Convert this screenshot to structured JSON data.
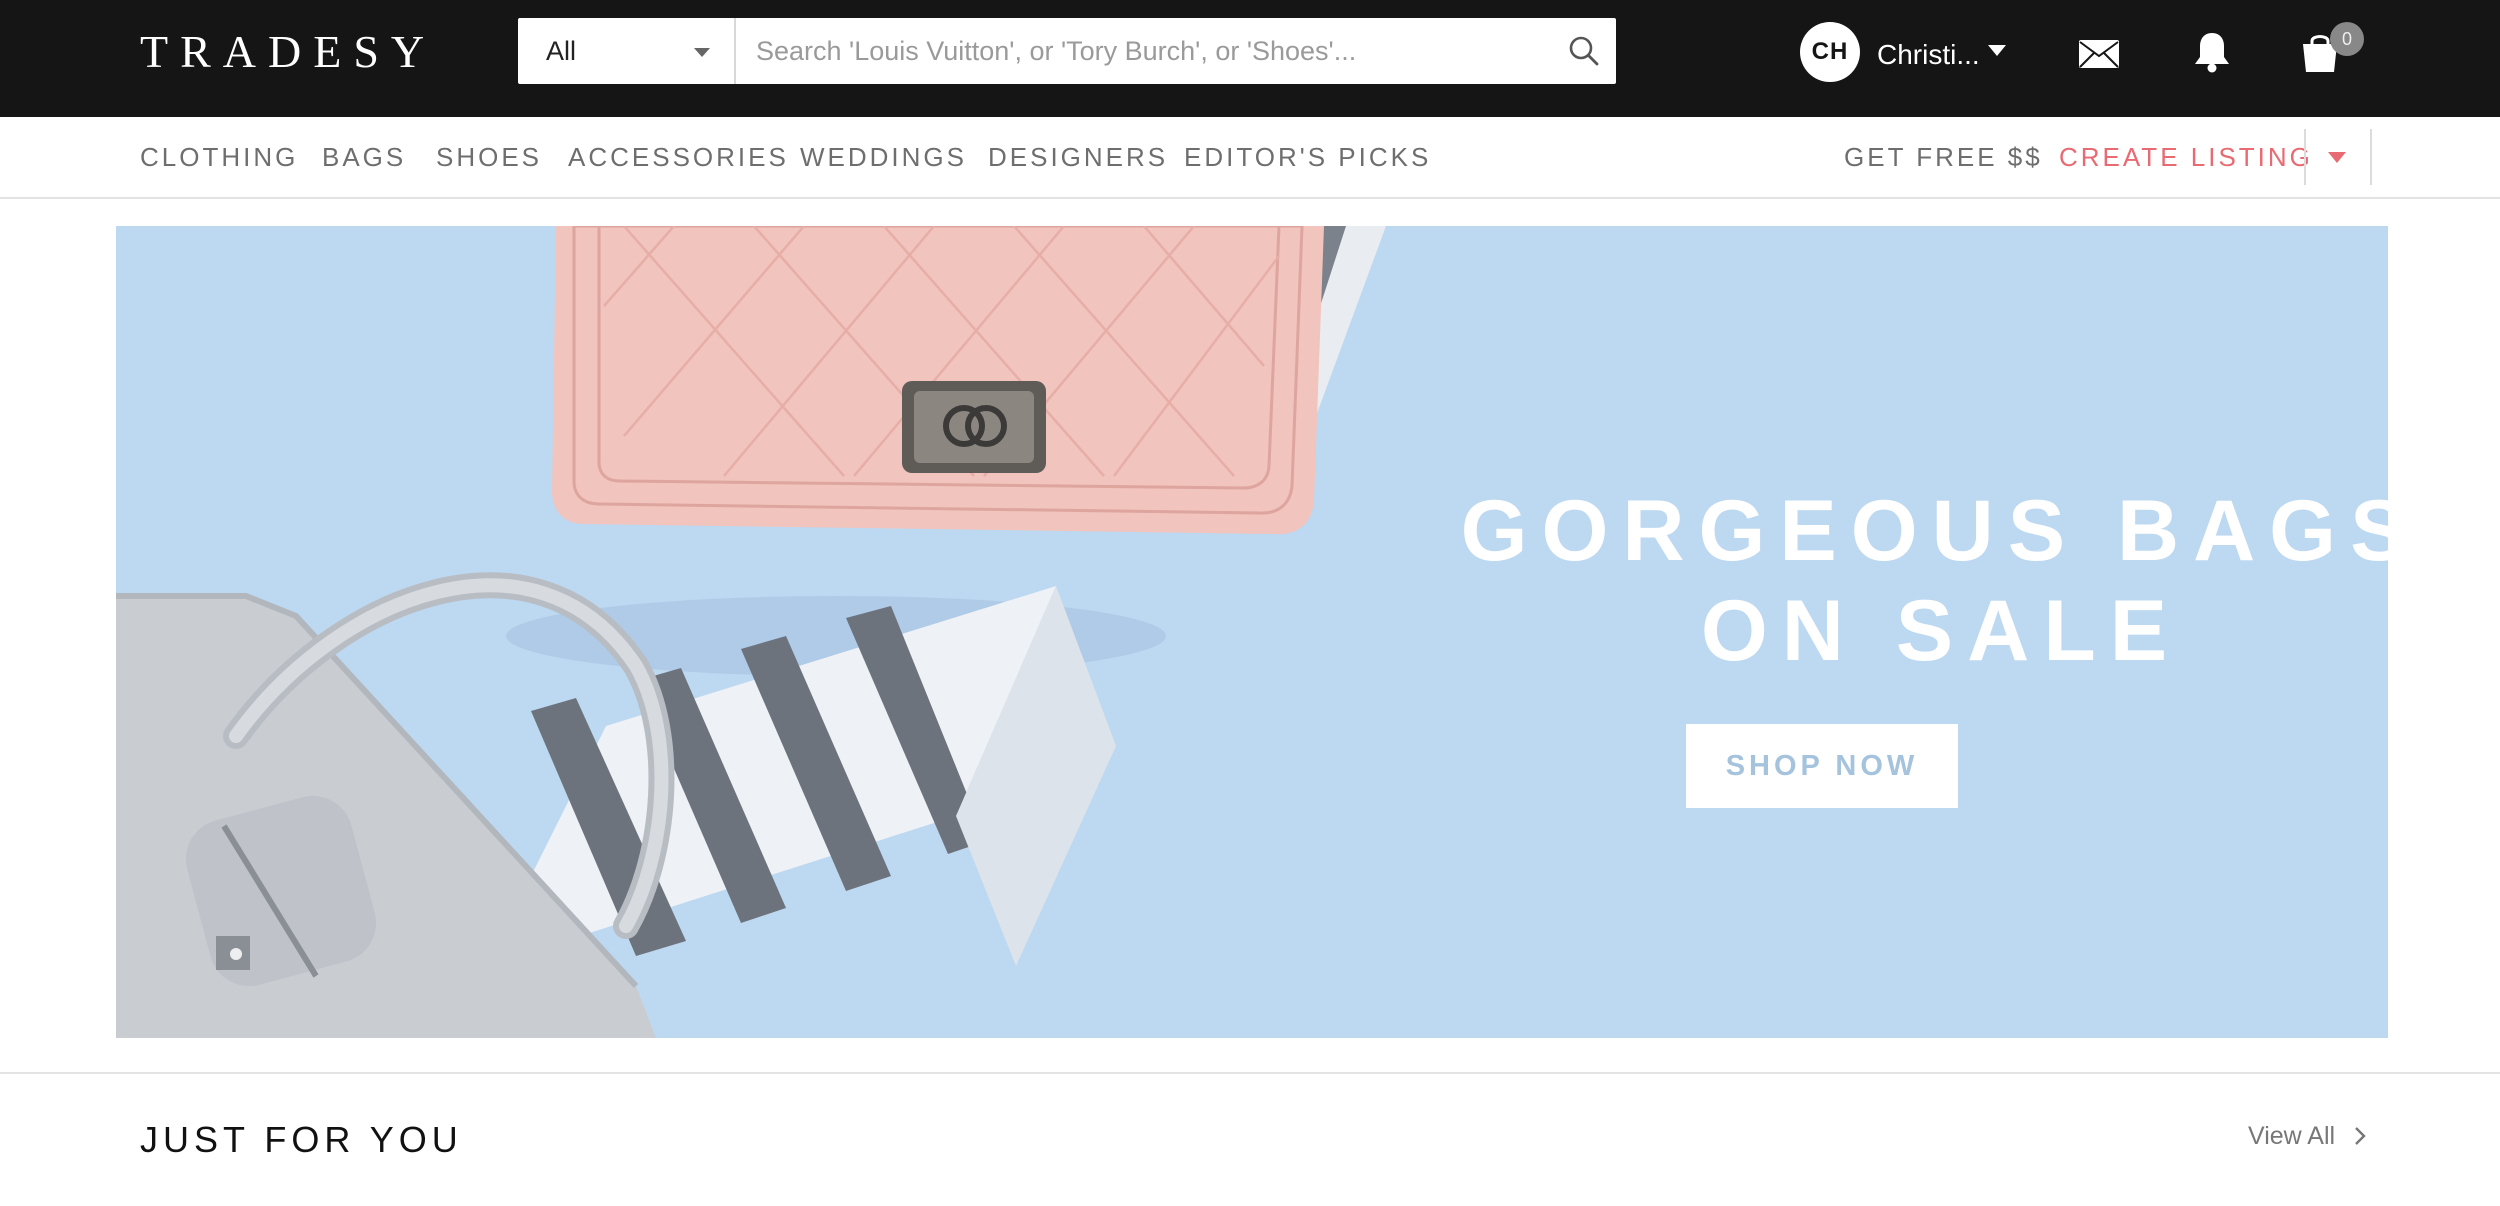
{
  "header": {
    "logo": "TRADESY",
    "search": {
      "category": "All",
      "placeholder": "Search 'Louis Vuitton', or 'Tory Burch', or 'Shoes'..."
    },
    "user": {
      "initials": "CH",
      "name": "Christi..."
    },
    "cart_count": "0",
    "icons": [
      "search-icon",
      "mail-icon",
      "bell-icon",
      "shopping-bag-icon",
      "chevron-down-icon"
    ]
  },
  "nav": {
    "items": [
      "CLOTHING",
      "BAGS",
      "SHOES",
      "ACCESSORIES",
      "WEDDINGS",
      "DESIGNERS",
      "EDITOR'S PICKS"
    ],
    "get_free": "GET FREE $$",
    "create_listing": "CREATE LISTING"
  },
  "hero": {
    "title_line1": "GORGEOUS BAGS",
    "title_line2": "ON SALE",
    "cta": "SHOP NOW"
  },
  "section": {
    "title": "JUST FOR YOU",
    "view_all": "View All"
  },
  "colors": {
    "topbar": "#151515",
    "accent": "#e86a72",
    "hero_bg": "#bdd8f1",
    "nav_text": "#6e6e6e"
  }
}
